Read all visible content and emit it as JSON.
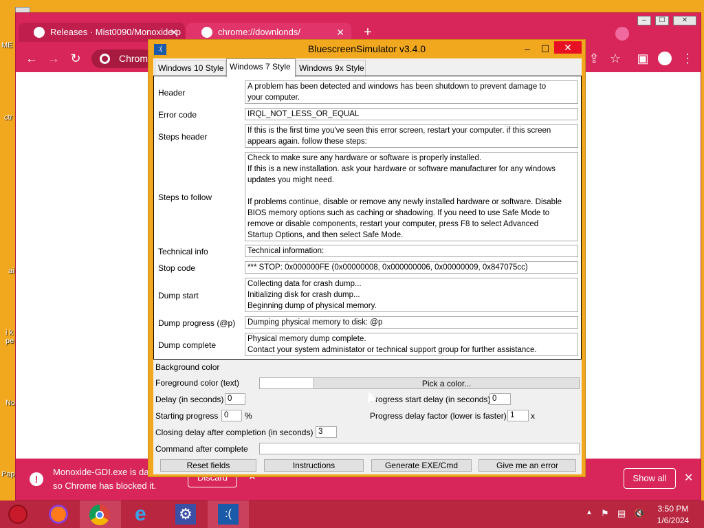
{
  "desktop": {
    "labels": [
      "ME",
      "ctr",
      "ai",
      "i k pe",
      "No",
      "Pap"
    ]
  },
  "browser": {
    "tabs": [
      {
        "label": "Releases · Mist0090/Monoxide-p",
        "close": "✕"
      },
      {
        "label": "chrome://downlonds/",
        "close": "✕"
      }
    ],
    "new_tab": "+",
    "omnibox": "Chrome",
    "download_bar": {
      "line1": "Monoxide-GDI.exe is da",
      "line2": "so Chrome has blocked it.",
      "discard": "Discard",
      "show_all": "Show all",
      "close": "✕"
    }
  },
  "app": {
    "title": "BluescreenSimulator v3.4.0",
    "icon_text": ":(",
    "tabs": [
      {
        "label": "Windows 10 Style"
      },
      {
        "label": "Windows 7 Style"
      },
      {
        "label": "Windows 9x Style"
      }
    ],
    "fields": [
      {
        "label": "Header",
        "value": "A problem has been detected and windows has been shutdown to prevent damage to\nyour computer."
      },
      {
        "label": "Error code",
        "value": "IRQL_NOT_LESS_OR_EQUAL"
      },
      {
        "label": "Steps header",
        "value": "If this is the first time you've seen this error screen, restart your computer. if this screen\nappears again. follow these steps:"
      },
      {
        "label": "Steps to follow",
        "value": "Check to make sure any hardware or software is properly installed.\nIf this is a new installation. ask your hardware or software manufacturer for any windows\nupdates you might need.\n\nIf problems continue, disable or remove any newly installed hardware or software. Disable\nBIOS memory options such as caching or shadowing. If you need to use Safe Mode to\nremove or disable components, restart your computer, press F8 to select Advanced\nStartup Options, and then select Safe Mode."
      },
      {
        "label": "Technical info",
        "value": "Technical information:"
      },
      {
        "label": "Stop code",
        "value": "*** STOP: 0x000000FE (0x00000008, 0x000000006, 0x00000009, 0x847075cc)"
      },
      {
        "label": "Dump start",
        "value": "Collecting data for crash dump...\nInitializing disk for crash dump...\nBeginning dump of physical memory."
      },
      {
        "label": "Dump progress (@p)",
        "value": "Dumping physical memory to disk: @p"
      },
      {
        "label": "Dump complete",
        "value": "Physical memory dump complete.\nContact your system administator or technical support group for further assistance."
      }
    ],
    "settings": {
      "background_color_label": "Background color",
      "foreground_color_label": "Foreground color (text)",
      "pick_color": "Pick a color...",
      "delay_label": "Delay (in seconds)",
      "delay_value": "0",
      "progress_start_delay_label": "Progress start delay (in seconds)",
      "progress_start_delay_value": "0",
      "starting_progress_label": "Starting progress",
      "starting_progress_value": "0",
      "starting_progress_unit": "%",
      "progress_delay_factor_label": "Progress delay factor (lower is faster)",
      "progress_delay_factor_value": "1",
      "progress_delay_factor_unit": "x",
      "closing_delay_label": "Closing delay after completion (in seconds)",
      "closing_delay_value": "3",
      "command_after_label": "Command after complete",
      "command_after_value": ""
    },
    "buttons": {
      "reset": "Reset fields",
      "instructions": "Instructions",
      "generate": "Generate EXE/Cmd",
      "error": "Give me an error"
    },
    "window_controls": {
      "minimize": "–",
      "maximize": "☐",
      "close": "✕"
    }
  },
  "taskbar": {
    "time": "3:50 PM",
    "date": "1/6/2024"
  },
  "colors": {
    "desktop": "#f2a81e",
    "chrome_theme": "#d8265a",
    "taskbar": "#b8263f"
  }
}
